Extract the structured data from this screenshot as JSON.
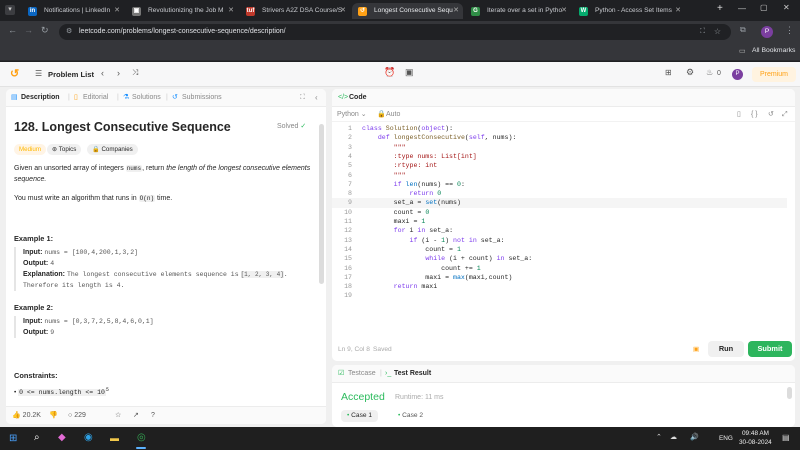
{
  "browser": {
    "tabs": [
      {
        "label": "Notifications | LinkedIn",
        "icon": "linkedin-icon",
        "color": "#0a66c2",
        "glyph": "in"
      },
      {
        "label": "Revolutionizing the Job M",
        "icon": "doc-icon",
        "color": "#777777",
        "glyph": "▣"
      },
      {
        "label": "Strivers A2Z DSA Course/S",
        "icon": "tuf-icon",
        "color": "#c0392b",
        "glyph": "tuf"
      },
      {
        "label": "Longest Consecutive Sequ",
        "icon": "leetcode-icon",
        "color": "#ffa116",
        "glyph": "↺"
      },
      {
        "label": "Iterate over a set in Pytho",
        "icon": "gfg-icon",
        "color": "#2f8d46",
        "glyph": "G"
      },
      {
        "label": "Python - Access Set Items",
        "icon": "w3schools-icon",
        "color": "#04aa6d",
        "glyph": "W"
      }
    ],
    "url": "leetcode.com/problems/longest-consecutive-sequence/description/",
    "bookmarks_label": "All Bookmarks",
    "profile_initial": "P"
  },
  "lc": {
    "problem_list": "Problem List",
    "premium": "Premium",
    "streak": "0",
    "tabs": [
      "Description",
      "Editorial",
      "Solutions",
      "Submissions"
    ],
    "title": "128. Longest Consecutive Sequence",
    "solved": "Solved",
    "difficulty": "Medium",
    "topics": "Topics",
    "companies": "Companies",
    "desc_prefix": "Given an unsorted array of integers",
    "desc_code": "nums",
    "desc_mid": ", return",
    "desc_em": "the length of the longest consecutive elements sequence.",
    "desc2_prefix": "You must write an algorithm that runs in",
    "desc2_code": "O(n)",
    "desc2_suffix": "time.",
    "ex1_title": "Example 1:",
    "ex1_input_label": "Input:",
    "ex1_input": "nums = [100,4,200,1,3,2]",
    "ex1_output_label": "Output:",
    "ex1_output": "4",
    "ex1_expl_label": "Explanation:",
    "ex1_expl_a": "The longest consecutive elements sequence is",
    "ex1_expl_code": "[1, 2, 3, 4]",
    "ex1_expl_b": ". Therefore its length is 4.",
    "ex2_title": "Example 2:",
    "ex2_input_label": "Input:",
    "ex2_input": "nums = [0,3,7,2,5,8,4,6,0,1]",
    "ex2_output_label": "Output:",
    "ex2_output": "9",
    "constraints_title": "Constraints:",
    "constraint1_base": "0 <= nums.length <= 10",
    "constraint1_exp": "5",
    "likes": "20.2K",
    "comments": "229",
    "code_title": "Code",
    "language": "Python",
    "auto": "Auto",
    "status": "Ln 9, Col 8",
    "saved": "Saved",
    "run": "Run",
    "submit": "Submit",
    "testcase": "Testcase",
    "test_result": "Test Result",
    "accepted": "Accepted",
    "runtime": "Runtime: 11 ms",
    "case1": "Case 1",
    "case2": "Case 2"
  },
  "code_lines": [
    "class Solution(object):",
    "    def longestConsecutive(self, nums):",
    "        \"\"\"",
    "        :type nums: List[int]",
    "        :rtype: int",
    "        \"\"\"",
    "        if len(nums) == 0:",
    "            return 0",
    "        set_a = set(nums)",
    "        count = 0",
    "        maxi = 1",
    "        for i in set_a:",
    "            if (i - 1) not in set_a:",
    "                count = 1",
    "                while (i + count) in set_a:",
    "                    count += 1",
    "                maxi = max(maxi,count)",
    "        return maxi",
    ""
  ],
  "taskbar": {
    "lang": "ENG",
    "time": "09:48 AM",
    "date": "30-08-2024"
  }
}
